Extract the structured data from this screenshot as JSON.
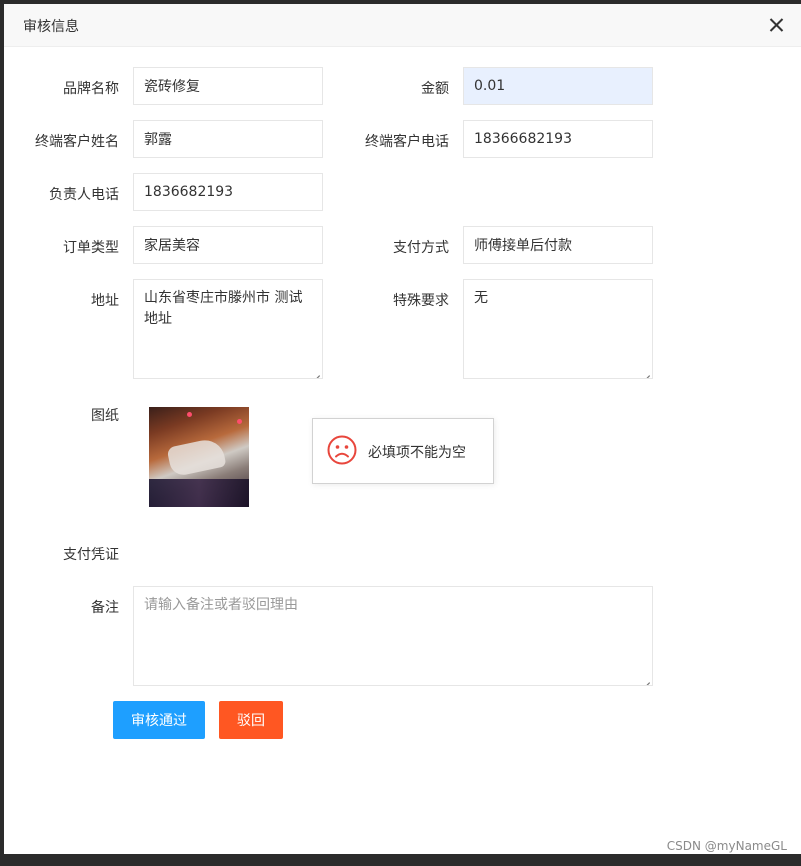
{
  "dialog": {
    "title": "审核信息"
  },
  "form": {
    "brand": {
      "label": "品牌名称",
      "value": "瓷砖修复"
    },
    "amount": {
      "label": "金额",
      "value": "0.01"
    },
    "customer_name": {
      "label": "终端客户姓名",
      "value": "郭露"
    },
    "customer_phone": {
      "label": "终端客户电话",
      "value": "18366682193"
    },
    "manager_phone": {
      "label": "负责人电话",
      "value": "1836682193"
    },
    "order_type": {
      "label": "订单类型",
      "value": "家居美容"
    },
    "payment_method": {
      "label": "支付方式",
      "value": "师傅接单后付款"
    },
    "address": {
      "label": "地址",
      "value": "山东省枣庄市滕州市 测试地址"
    },
    "special": {
      "label": "特殊要求",
      "value": "无"
    },
    "drawing": {
      "label": "图纸"
    },
    "voucher": {
      "label": "支付凭证"
    },
    "remark": {
      "label": "备注",
      "placeholder": "请输入备注或者驳回理由",
      "value": ""
    }
  },
  "toast": {
    "message": "必填项不能为空",
    "icon": "sad-face-icon",
    "color": "#e8463c"
  },
  "actions": {
    "approve": "审核通过",
    "reject": "驳回"
  },
  "colors": {
    "approve": "#1e9fff",
    "reject": "#ff5722"
  },
  "watermark": "CSDN @myNameGL"
}
